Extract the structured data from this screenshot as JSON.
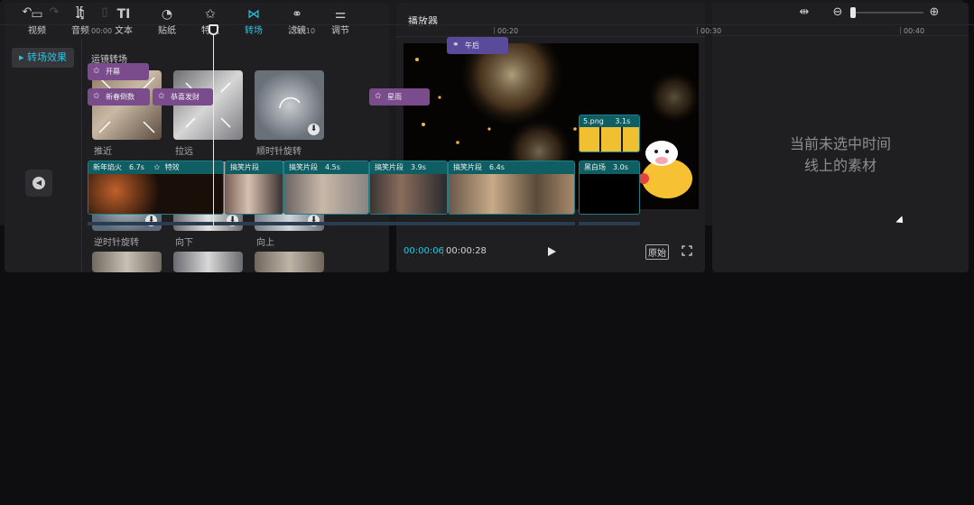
{
  "toolbar": {
    "tabs": [
      {
        "label": "视频",
        "icon": "video-icon"
      },
      {
        "label": "音频",
        "icon": "music-icon"
      },
      {
        "label": "文本",
        "icon": "text-icon"
      },
      {
        "label": "贴纸",
        "icon": "sticker-icon"
      },
      {
        "label": "特效",
        "icon": "effects-icon"
      },
      {
        "label": "转场",
        "icon": "transition-icon"
      },
      {
        "label": "滤镜",
        "icon": "filter-icon"
      },
      {
        "label": "调节",
        "icon": "adjust-icon"
      }
    ],
    "active_tab": "转场"
  },
  "left_sidebar": {
    "items": [
      {
        "label": "▸ 转场效果"
      }
    ]
  },
  "transitions": {
    "section_title": "运镜转场",
    "items": [
      {
        "label": "推近",
        "downloadable": false
      },
      {
        "label": "拉远",
        "downloadable": false
      },
      {
        "label": "顺时针旋转",
        "downloadable": true
      },
      {
        "label": "逆时针旋转",
        "downloadable": true
      },
      {
        "label": "向下",
        "downloadable": true
      },
      {
        "label": "向上",
        "downloadable": true
      }
    ]
  },
  "player": {
    "title": "播放器",
    "current_time": "00:00:06",
    "separator": "|",
    "total_time": "00:00:28",
    "original_label": "原始"
  },
  "properties": {
    "empty_message_line1": "当前未选中时间",
    "empty_message_line2": "线上的素材"
  },
  "timeline": {
    "ruler_labels": [
      "00:00",
      "00:10",
      "00:20",
      "00:30",
      "00:40"
    ],
    "effects": [
      {
        "label": "午后",
        "track": 0
      },
      {
        "label": "开幕",
        "track": 1
      },
      {
        "label": "新春倒数",
        "track": 2
      },
      {
        "label": "恭喜发财",
        "track": 2
      },
      {
        "label": "星雨",
        "track": 2
      }
    ],
    "overlay_clip": {
      "name": "5.png",
      "duration": "3.1s"
    },
    "main_clips": [
      {
        "name": "新年焰火",
        "duration": "6.7s",
        "extra": "特效"
      },
      {
        "name": "搞笑片段",
        "duration": ""
      },
      {
        "name": "搞笑片段",
        "duration": "4.5s"
      },
      {
        "name": "搞笑片段",
        "duration": "3.9s"
      },
      {
        "name": "搞笑片段",
        "duration": "6.4s"
      },
      {
        "name": "黑白场",
        "duration": "3.0s"
      }
    ]
  },
  "colors": {
    "accent": "#29c4e0",
    "clip_border": "#1e7f86",
    "effect_purple": "#7a4c8c",
    "filter_blue": "#5a4a9a"
  }
}
